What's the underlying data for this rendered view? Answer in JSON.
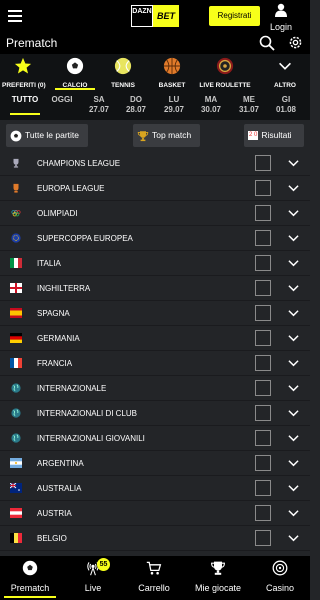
{
  "header": {
    "logo_dazn": "DAZN",
    "logo_bet": "BET",
    "register_label": "Registrati",
    "login_label": "Login",
    "page_title": "Prematch"
  },
  "sports": [
    {
      "label": "PREFERITI (0)",
      "icon": "star-icon"
    },
    {
      "label": "CALCIO",
      "icon": "football-icon"
    },
    {
      "label": "TENNIS",
      "icon": "tennis-ball-icon"
    },
    {
      "label": "BASKET",
      "icon": "basketball-icon"
    },
    {
      "label": "LIVE ROULETTE",
      "icon": "roulette-icon"
    },
    {
      "label": "ALTRO",
      "icon": "chevron-down-icon"
    }
  ],
  "dates": [
    {
      "day": "TUTTO",
      "date": ""
    },
    {
      "day": "OGGI",
      "date": ""
    },
    {
      "day": "SA",
      "date": "27.07"
    },
    {
      "day": "DO",
      "date": "28.07"
    },
    {
      "day": "LU",
      "date": "29.07"
    },
    {
      "day": "MA",
      "date": "30.07"
    },
    {
      "day": "ME",
      "date": "31.07"
    },
    {
      "day": "GI",
      "date": "01.08"
    }
  ],
  "filters": {
    "all_matches": "Tutte le partite",
    "top_match": "Top match",
    "results": "Risultati",
    "results_score": "2 0"
  },
  "leagues": [
    {
      "name": "CHAMPIONS LEAGUE",
      "icon": "champions-league-trophy-icon"
    },
    {
      "name": "EUROPA LEAGUE",
      "icon": "europa-league-trophy-icon"
    },
    {
      "name": "OLIMPIADI",
      "icon": "olympic-rings-icon"
    },
    {
      "name": "SUPERCOPPA EUROPEA",
      "icon": "eu-flag-icon"
    },
    {
      "name": "ITALIA",
      "icon": "italy-flag-icon"
    },
    {
      "name": "INGHILTERRA",
      "icon": "england-flag-icon"
    },
    {
      "name": "SPAGNA",
      "icon": "spain-flag-icon"
    },
    {
      "name": "GERMANIA",
      "icon": "germany-flag-icon"
    },
    {
      "name": "FRANCIA",
      "icon": "france-flag-icon"
    },
    {
      "name": "INTERNAZIONALE",
      "icon": "globe-icon"
    },
    {
      "name": "INTERNAZIONALI DI CLUB",
      "icon": "globe-icon"
    },
    {
      "name": "INTERNAZIONALI GIOVANILI",
      "icon": "globe-icon"
    },
    {
      "name": "ARGENTINA",
      "icon": "argentina-flag-icon"
    },
    {
      "name": "AUSTRALIA",
      "icon": "australia-flag-icon"
    },
    {
      "name": "AUSTRIA",
      "icon": "austria-flag-icon"
    },
    {
      "name": "BELGIO",
      "icon": "belgium-flag-icon"
    }
  ],
  "bottom_nav": [
    {
      "label": "Prematch",
      "icon": "football-icon"
    },
    {
      "label": "Live",
      "icon": "live-antenna-icon",
      "badge": "55"
    },
    {
      "label": "Carrello",
      "icon": "cart-icon"
    },
    {
      "label": "Mie giocate",
      "icon": "trophy-icon"
    },
    {
      "label": "Casino",
      "icon": "roulette-icon"
    }
  ],
  "colors": {
    "accent": "#f7ff1a",
    "background": "#232528",
    "header": "#000000"
  }
}
